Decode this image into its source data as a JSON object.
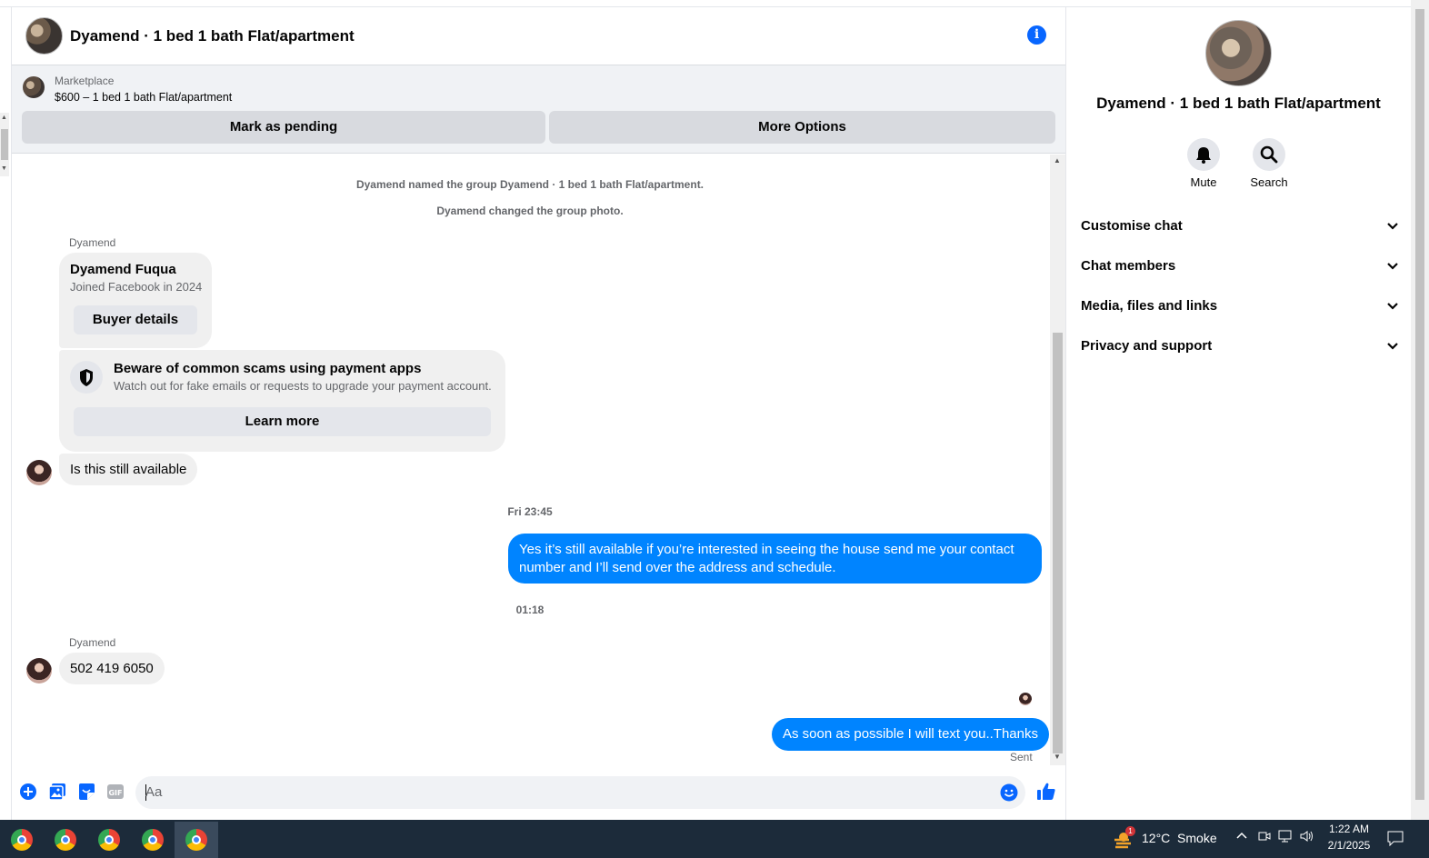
{
  "conversation": {
    "title": "Dyamend · 1 bed 1 bath Flat/apartment",
    "listing": {
      "label": "Marketplace",
      "item": "$600 – 1 bed 1 bath Flat/apartment",
      "mark_pending": "Mark as pending",
      "more_options": "More Options"
    },
    "system_messages": [
      "Dyamend named the group Dyamend · 1 bed 1 bath Flat/apartment.",
      "Dyamend changed the group photo."
    ],
    "buyer_card": {
      "sender": "Dyamend",
      "name": "Dyamend Fuqua",
      "joined": "Joined Facebook in 2024",
      "button": "Buyer details"
    },
    "scam_card": {
      "title": "Beware of common scams using payment apps",
      "body": "Watch out for fake emails or requests to upgrade your payment account.",
      "button": "Learn more"
    },
    "messages": {
      "m1": "Is this still available",
      "ts1": "Fri 23:45",
      "m2": "Yes it’s still available if you’re interested in seeing the house send me your contact number and I’ll send over the address and schedule.",
      "ts2": "01:18",
      "sender2": "Dyamend",
      "m3": "502 419 6050",
      "m4": "As soon as possible I will text you..Thanks",
      "status": "Sent"
    },
    "composer": {
      "placeholder": "Aa",
      "icons": [
        "plus-icon",
        "photo-icon",
        "sticker-icon",
        "gif-icon",
        "emoji-icon",
        "like-icon"
      ],
      "gif_label": "GIF"
    }
  },
  "info_panel": {
    "title": "Dyamend · 1 bed 1 bath Flat/apartment",
    "mute": "Mute",
    "search": "Search",
    "sections": [
      "Customise chat",
      "Chat members",
      "Media, files and links",
      "Privacy and support"
    ]
  },
  "taskbar": {
    "weather": "12°C  Smoke",
    "weather_badge": "1",
    "time": "1:22 AM",
    "date": "2/1/2025"
  },
  "colors": {
    "accent": "#0866ff",
    "outgoing_bubble": "#0084ff",
    "incoming_bubble": "#f0f0f0",
    "taskbar": "#1c2b3a"
  }
}
